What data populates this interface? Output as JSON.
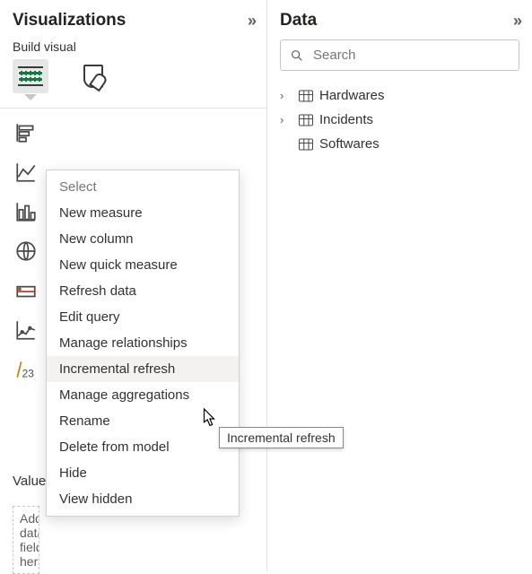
{
  "viz": {
    "title": "Visualizations",
    "subtitle": "Build visual",
    "values_label": "Values",
    "add_placeholder": "Add data fields here"
  },
  "data": {
    "title": "Data",
    "search_placeholder": "Search",
    "tables": [
      {
        "name": "Hardwares"
      },
      {
        "name": "Incidents"
      },
      {
        "name": "Softwares"
      }
    ]
  },
  "context_menu": {
    "items": [
      "Select",
      "New measure",
      "New column",
      "New quick measure",
      "Refresh data",
      "Edit query",
      "Manage relationships",
      "Incremental refresh",
      "Manage aggregations",
      "Rename",
      "Delete from model",
      "Hide",
      "View hidden"
    ],
    "hovered_index": 7
  },
  "tooltip": "Incremental refresh"
}
